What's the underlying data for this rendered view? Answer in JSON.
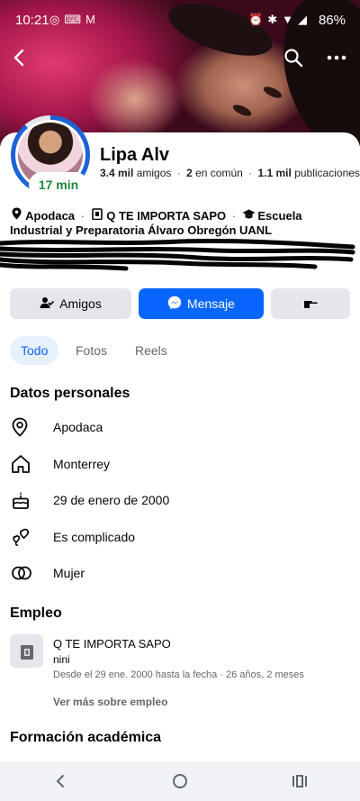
{
  "status_bar": {
    "time": "10:21",
    "battery": "86%",
    "app_icons": [
      "whatsapp-icon",
      "game-controller-icon",
      "gmail-icon"
    ],
    "system_icons": [
      "alarm-icon",
      "bluetooth-icon",
      "wifi-icon",
      "signal-icon"
    ]
  },
  "profile": {
    "name": "Lipa Alv",
    "active_badge": "17 min",
    "stats": {
      "friends_count": "3.4 mil",
      "friends_label": "amigos",
      "mutual_count": "2",
      "mutual_label": "en común",
      "posts_count": "1.1 mil",
      "posts_label": "publicaciones"
    },
    "location": "Apodaca",
    "workplace": "Q TE IMPORTA SAPO",
    "school": "Escuela Industrial y Preparatoria Álvaro Obregón UANL"
  },
  "actions": {
    "friends_button": "Amigos",
    "message_button": "Mensaje"
  },
  "tabs": [
    {
      "label": "Todo",
      "active": true
    },
    {
      "label": "Fotos",
      "active": false
    },
    {
      "label": "Reels",
      "active": false
    }
  ],
  "personal": {
    "title": "Datos personales",
    "items": [
      {
        "icon": "location-pin-icon",
        "label": "Apodaca"
      },
      {
        "icon": "home-icon",
        "label": "Monterrey"
      },
      {
        "icon": "birthday-cake-icon",
        "label": "29 de enero de 2000"
      },
      {
        "icon": "hearts-icon",
        "label": "Es complicado"
      },
      {
        "icon": "interlocking-rings-icon",
        "label": "Mujer"
      }
    ]
  },
  "employment": {
    "title": "Empleo",
    "company": "Q TE IMPORTA SAPO",
    "role": "nini",
    "dates": "Desde el 29 ene. 2000 hasta la fecha · 26 años, 2 meses",
    "more_link": "Ver más sobre empleo"
  },
  "education": {
    "title": "Formación académica"
  },
  "colors": {
    "accent": "#0866ff",
    "active_green": "#1c8a3a",
    "button_gray": "#e4e6eb",
    "tab_active_bg": "#e7f0fd",
    "secondary_text": "#65676b"
  }
}
